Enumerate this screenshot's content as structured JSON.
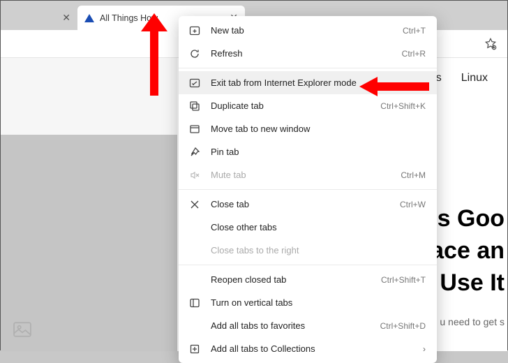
{
  "tabs": {
    "active_title": "All Things How"
  },
  "nav": {
    "item1": "ows",
    "item2": "Linux"
  },
  "article": {
    "title_l1": "is Goo",
    "title_l2": "ace an",
    "title_l3": "Use It",
    "subtitle": "u need to get s"
  },
  "menu": [
    {
      "label": "New tab",
      "shortcut": "Ctrl+T",
      "icon": "newtab"
    },
    {
      "label": "Refresh",
      "shortcut": "Ctrl+R",
      "icon": "refresh"
    },
    {
      "sep": true
    },
    {
      "label": "Exit tab from Internet Explorer mode",
      "icon": "ie",
      "highlight": true
    },
    {
      "label": "Duplicate tab",
      "shortcut": "Ctrl+Shift+K",
      "icon": "duplicate"
    },
    {
      "label": "Move tab to new window",
      "icon": "window"
    },
    {
      "label": "Pin tab",
      "icon": "pin"
    },
    {
      "label": "Mute tab",
      "shortcut": "Ctrl+M",
      "icon": "mute",
      "disabled": true
    },
    {
      "sep": true
    },
    {
      "label": "Close tab",
      "shortcut": "Ctrl+W",
      "icon": "close"
    },
    {
      "label": "Close other tabs"
    },
    {
      "label": "Close tabs to the right",
      "disabled": true
    },
    {
      "sep": true
    },
    {
      "label": "Reopen closed tab",
      "shortcut": "Ctrl+Shift+T"
    },
    {
      "label": "Turn on vertical tabs",
      "icon": "vtabs"
    },
    {
      "label": "Add all tabs to favorites",
      "shortcut": "Ctrl+Shift+D"
    },
    {
      "label": "Add all tabs to Collections",
      "icon": "collections",
      "submenu": true
    }
  ]
}
